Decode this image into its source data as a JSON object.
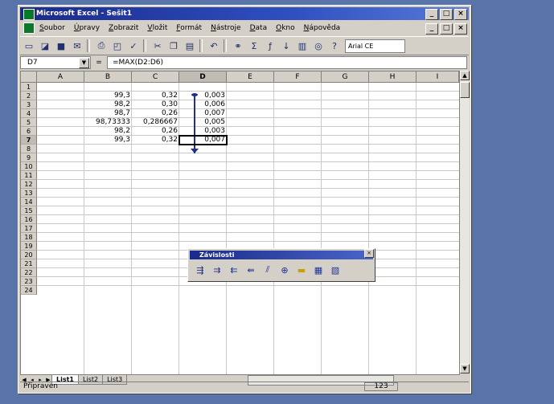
{
  "window": {
    "title": "Microsoft Excel - Sešit1",
    "controls": [
      "_",
      "□",
      "×"
    ]
  },
  "menu": [
    "Soubor",
    "Úpravy",
    "Zobrazit",
    "Vložit",
    "Formát",
    "Nástroje",
    "Data",
    "Okno",
    "Nápověda"
  ],
  "toolbar": {
    "font": "Arial CE",
    "icons": [
      "new-icon",
      "open-icon",
      "save-icon",
      "email-icon",
      "print-icon",
      "preview-icon",
      "spell-icon",
      "cut-icon",
      "copy-icon",
      "paste-icon",
      "undo-icon",
      "hyperlink-icon",
      "sum-icon",
      "function-icon",
      "sort-asc-icon",
      "sort-desc-icon",
      "chart-icon",
      "map-icon",
      "zoom-icon"
    ]
  },
  "formula": {
    "cell_ref": "D7",
    "eq": "=",
    "text": "=MAX(D2:D6)"
  },
  "columns": [
    "A",
    "B",
    "C",
    "D",
    "E",
    "F",
    "G",
    "H",
    "I"
  ],
  "rows": [
    "1",
    "2",
    "3",
    "4",
    "5",
    "6",
    "7",
    "8",
    "9",
    "10",
    "11",
    "12",
    "13",
    "14",
    "15",
    "16",
    "17",
    "18",
    "19",
    "20",
    "21",
    "22",
    "23",
    "24"
  ],
  "cells": {
    "b2": "99,3",
    "c2": "0,32",
    "d2": "0,003",
    "b3": "98,2",
    "c3": "0,30",
    "d3": "0,006",
    "b4": "98,7",
    "c4": "0,26",
    "d4": "0,007",
    "b5": "98,73333",
    "c5": "0,286667",
    "d5": "0,005",
    "b6": "98,2",
    "c6": "0,26",
    "d6": "0,003",
    "b7": "99,3",
    "c7": "0,32",
    "d7": "0,007"
  },
  "float_toolbar": {
    "title": "Závislosti",
    "close": "×",
    "icons": [
      "trace-precedents-icon",
      "remove-precedent-icon",
      "trace-dependents-icon",
      "remove-dependent-icon",
      "remove-all-arrows-icon",
      "trace-error-icon",
      "new-comment-icon",
      "circle-invalid-icon",
      "clear-circles-icon"
    ]
  },
  "sheets": [
    "List1",
    "List2",
    "List3"
  ],
  "status": {
    "left": "Připraven",
    "right": "123"
  }
}
